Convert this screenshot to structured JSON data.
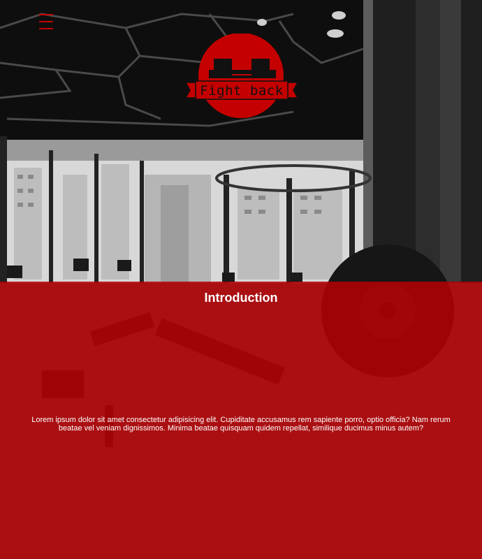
{
  "header": {
    "menu_icon": "hamburger-menu-icon",
    "logo_text": "Fight back",
    "logo_icon": "dumbbell-icon"
  },
  "intro": {
    "title": "Introduction",
    "body": "Lorem ipsum dolor sit amet consectetur adipisicing elit. Cupiditate accusamus rem sapiente porro, optio officia? Nam rerum beatae vel veniam dignissimos. Minima beatae quisquam quidem repellat, similique ducimus minus autem?"
  },
  "colors": {
    "accent": "#c40000",
    "overlay": "#b40004",
    "text": "#ffffff"
  }
}
